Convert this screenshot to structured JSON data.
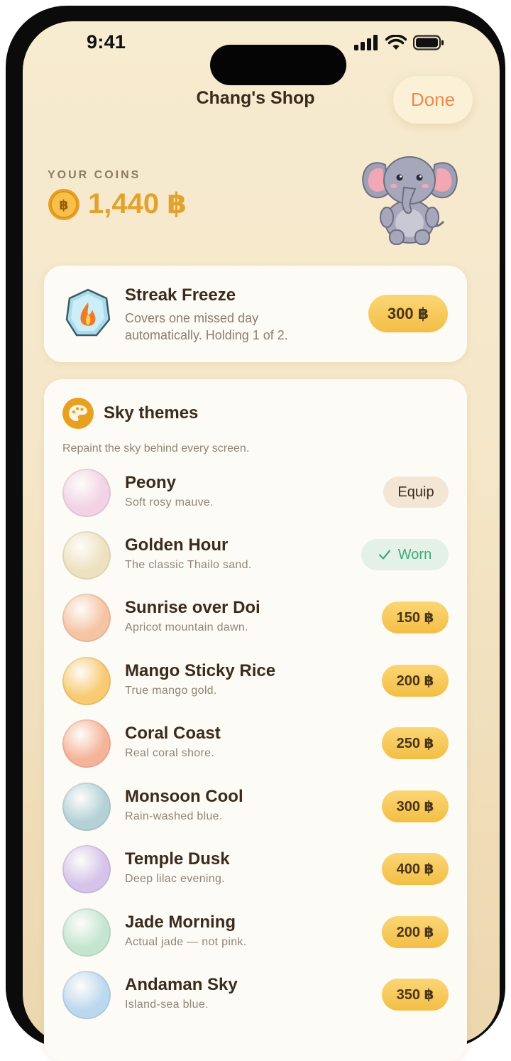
{
  "status": {
    "time": "9:41"
  },
  "nav": {
    "title": "Chang's Shop",
    "done_label": "Done"
  },
  "wallet": {
    "label": "YOUR COINS",
    "value": "1,440 ฿"
  },
  "freeze": {
    "title": "Streak Freeze",
    "description": "Covers one missed day automatically. Holding 1 of 2.",
    "price": "300 ฿"
  },
  "themes": {
    "title": "Sky themes",
    "subtitle": "Repaint the sky behind every screen.",
    "items": [
      {
        "name": "Peony",
        "description": "Soft rosy mauve.",
        "action": "Equip",
        "state": "equip",
        "color": "#f2d2e4"
      },
      {
        "name": "Golden Hour",
        "description": "The classic Thailo sand.",
        "action": "Worn",
        "state": "worn",
        "color": "#eee1c0"
      },
      {
        "name": "Sunrise over Doi",
        "description": "Apricot mountain dawn.",
        "action": "150 ฿",
        "state": "price",
        "color": "#f6c4a4"
      },
      {
        "name": "Mango Sticky Rice",
        "description": "True mango gold.",
        "action": "200 ฿",
        "state": "price",
        "color": "#f8ca72"
      },
      {
        "name": "Coral Coast",
        "description": "Real coral shore.",
        "action": "250 ฿",
        "state": "price",
        "color": "#f5b49a"
      },
      {
        "name": "Monsoon Cool",
        "description": "Rain-washed blue.",
        "action": "300 ฿",
        "state": "price",
        "color": "#b4d1d8"
      },
      {
        "name": "Temple Dusk",
        "description": "Deep lilac evening.",
        "action": "400 ฿",
        "state": "price",
        "color": "#d5c3ea"
      },
      {
        "name": "Jade Morning",
        "description": "Actual jade — not pink.",
        "action": "200 ฿",
        "state": "price",
        "color": "#c4e5d0"
      },
      {
        "name": "Andaman Sky",
        "description": "Island-sea blue.",
        "action": "350 ฿",
        "state": "price",
        "color": "#bcd8ef"
      }
    ]
  },
  "colors": {
    "accent_gold": "#f3be45",
    "done_text": "#ec8a4e",
    "worn_green": "#3fa97a",
    "coin_text": "#e3a22b"
  }
}
